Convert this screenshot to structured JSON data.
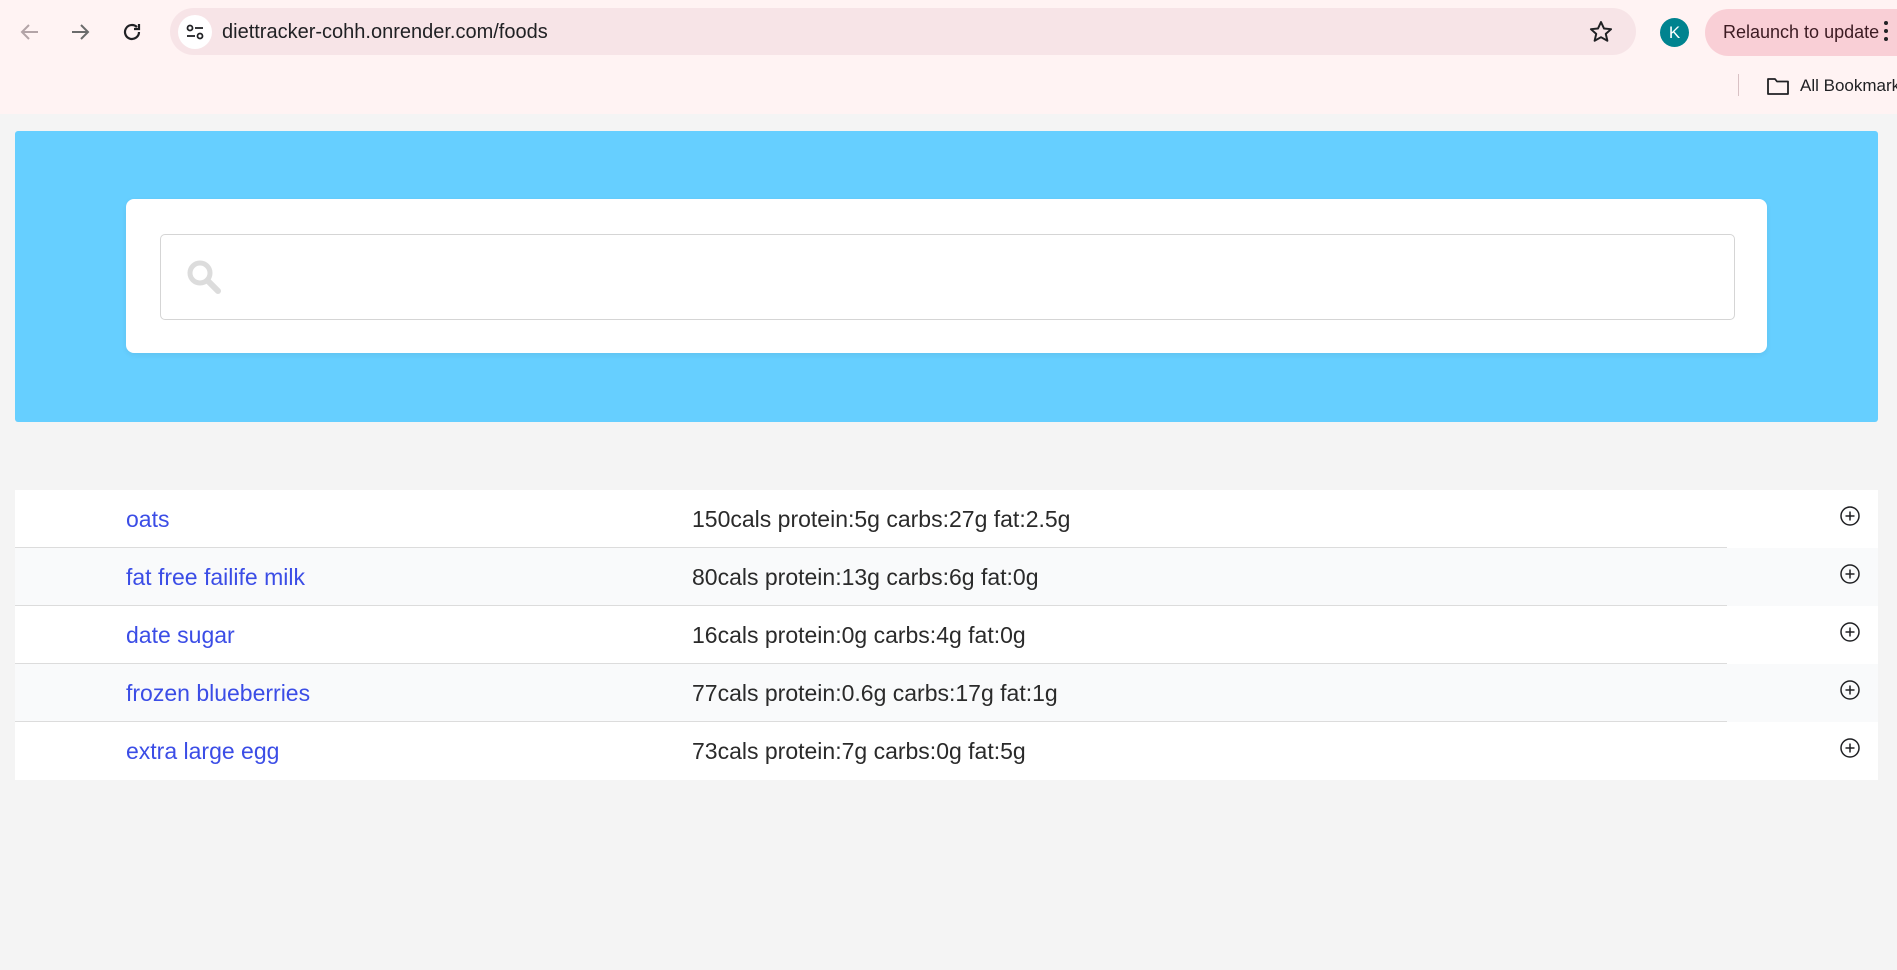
{
  "browser": {
    "url": "diettracker-cohh.onrender.com/foods",
    "profile_initial": "K",
    "relaunch_label": "Relaunch to update",
    "bookmarks_label": "All Bookmarks"
  },
  "search": {
    "placeholder": "",
    "value": ""
  },
  "foods": [
    {
      "name": "oats",
      "nutrition": "150cals protein:5g carbs:27g fat:2.5g"
    },
    {
      "name": "fat free failife milk",
      "nutrition": "80cals protein:13g carbs:6g fat:0g"
    },
    {
      "name": "date sugar",
      "nutrition": "16cals protein:0g carbs:4g fat:0g"
    },
    {
      "name": "frozen blueberries",
      "nutrition": "77cals protein:0.6g carbs:17g fat:1g"
    },
    {
      "name": "extra large egg",
      "nutrition": "73cals protein:7g carbs:0g fat:5g"
    }
  ],
  "colors": {
    "hero_background": "#66cfff",
    "link": "#3b4de6",
    "avatar": "#00838f"
  }
}
